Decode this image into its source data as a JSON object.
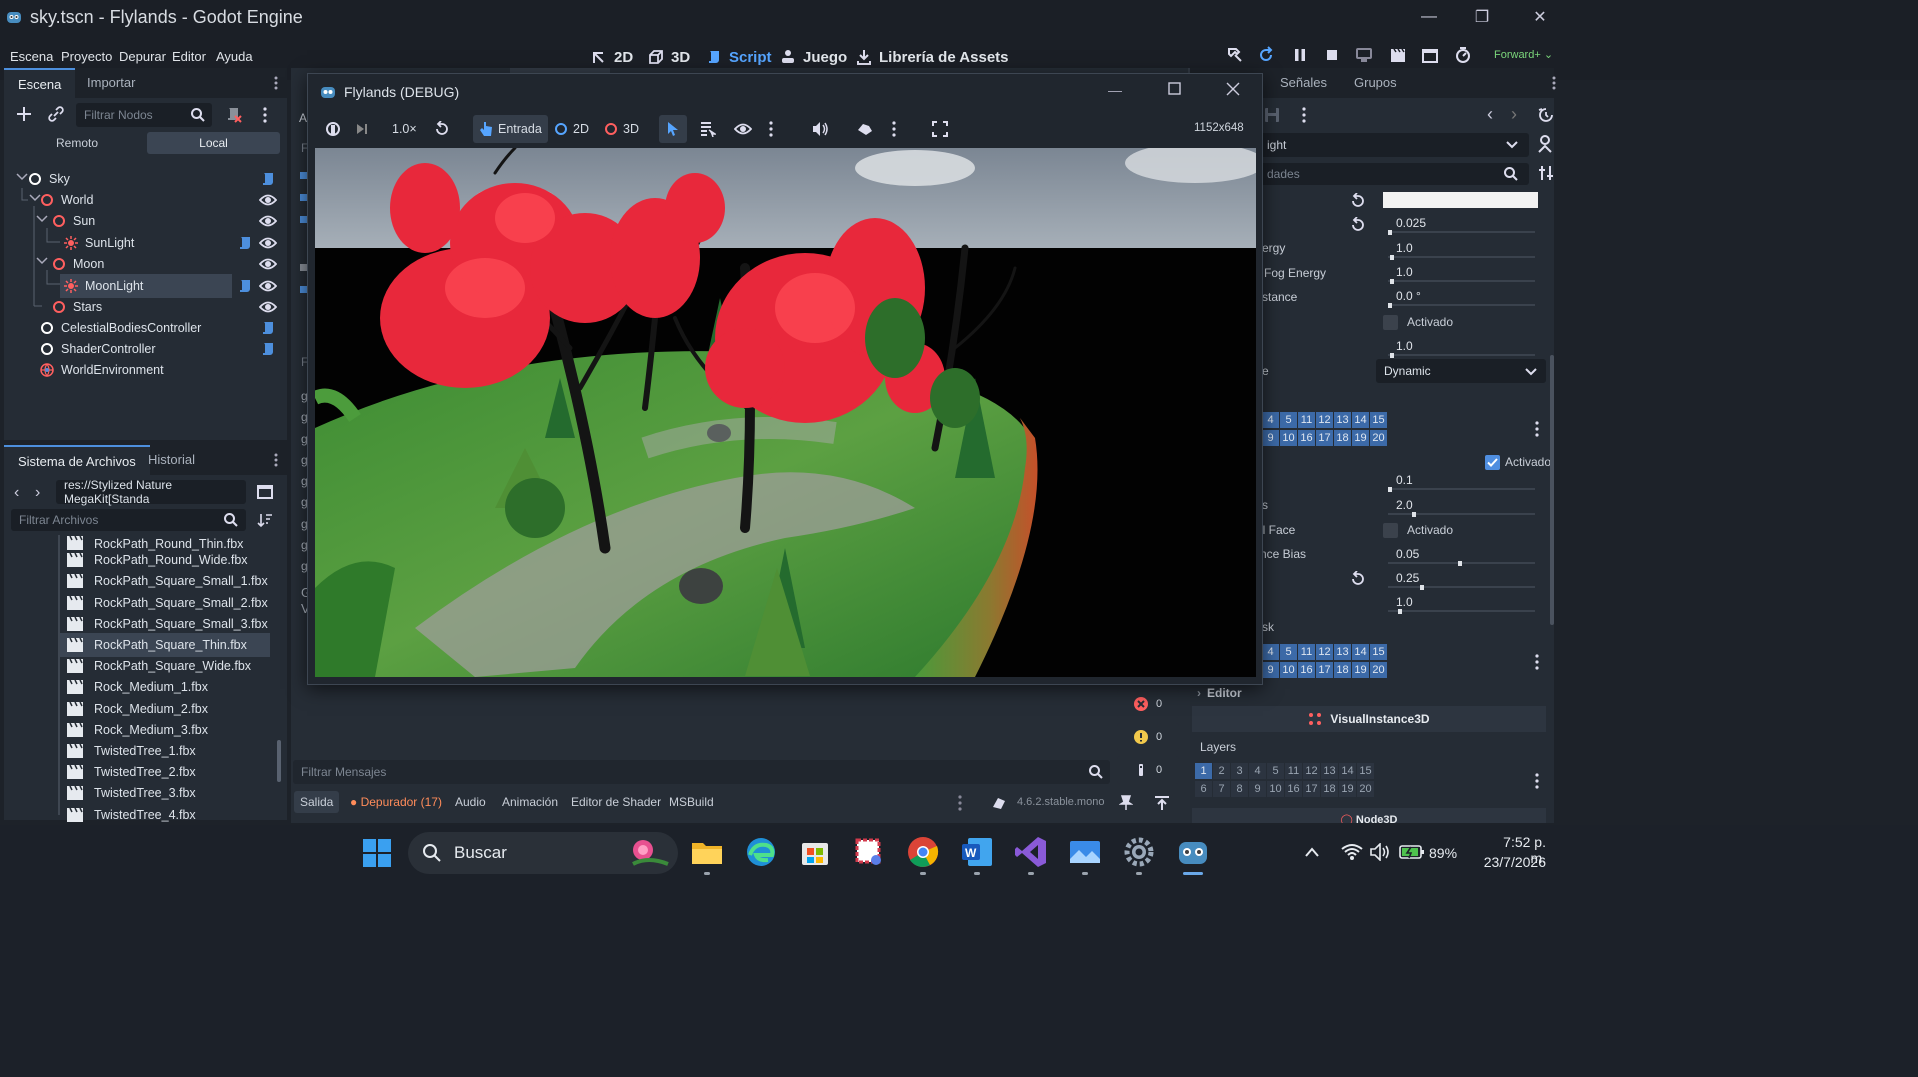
{
  "window": {
    "title": "sky.tscn - Flylands - Godot Engine",
    "minimize": "—",
    "maximize": "❐",
    "close": "✕"
  },
  "menu": [
    "Escena",
    "Proyecto",
    "Depurar",
    "Editor",
    "Ayuda"
  ],
  "workspaces": [
    {
      "label": "2D",
      "icon": "2d-icon"
    },
    {
      "label": "3D",
      "icon": "3d-icon"
    },
    {
      "label": "Script",
      "icon": "script-icon",
      "active": true
    },
    {
      "label": "Juego",
      "icon": "game-icon"
    },
    {
      "label": "Librería de Assets",
      "icon": "asset-library-icon"
    }
  ],
  "renderer": "Forward+",
  "scene_dock": {
    "tabs": [
      "Escena",
      "Importar"
    ],
    "filter_placeholder": "Filtrar Nodos",
    "remote_label": "Remoto",
    "local_label": "Local",
    "nodes": [
      {
        "name": "Sky",
        "icon": "node3d-icon"
      },
      {
        "name": "World",
        "icon": "node3d-icon"
      },
      {
        "name": "Sun",
        "icon": "node3d-icon"
      },
      {
        "name": "SunLight",
        "icon": "directional-light-icon"
      },
      {
        "name": "Moon",
        "icon": "node3d-icon"
      },
      {
        "name": "MoonLight",
        "icon": "directional-light-icon",
        "selected": true
      },
      {
        "name": "Stars",
        "icon": "node3d-icon"
      },
      {
        "name": "CelestialBodiesController",
        "icon": "node-icon"
      },
      {
        "name": "ShaderController",
        "icon": "node-icon"
      },
      {
        "name": "WorldEnvironment",
        "icon": "world-environment-icon"
      }
    ]
  },
  "filesystem_dock": {
    "tabs": [
      "Sistema de Archivos",
      "Historial"
    ],
    "path": "res://Stylized Nature MegaKit[Standa",
    "filter_placeholder": "Filtrar Archivos",
    "files": [
      "RockPath_Round_Thin.fbx",
      "RockPath_Round_Wide.fbx",
      "RockPath_Square_Small_1.fbx",
      "RockPath_Square_Small_2.fbx",
      "RockPath_Square_Small_3.fbx",
      "RockPath_Square_Thin.fbx",
      "RockPath_Square_Wide.fbx",
      "Rock_Medium_1.fbx",
      "Rock_Medium_2.fbx",
      "Rock_Medium_3.fbx",
      "TwistedTree_1.fbx",
      "TwistedTree_2.fbx",
      "TwistedTree_3.fbx",
      "TwistedTree_4.fbx"
    ],
    "selected_file": "RockPath_Square_Thin.fbx"
  },
  "debug_window": {
    "title": "Flylands (DEBUG)",
    "speed": "1.0×",
    "input_label": "Entrada",
    "mode_2d": "2D",
    "mode_3d": "3D",
    "resolution": "1152x648"
  },
  "behind_fragments": {
    "tab_a": "A",
    "f1": "F",
    "f2": "F",
    "g_letters": [
      "g",
      "g",
      "g",
      "g",
      "g",
      "g",
      "g",
      "g",
      "g",
      "g"
    ],
    "gv": [
      "G",
      "V"
    ]
  },
  "inspector": {
    "tabs": [
      "Señales",
      "Grupos"
    ],
    "object_name": "ight",
    "filter_fragment": "dades",
    "properties": [
      {
        "label": "",
        "value": "0.025",
        "revert": true
      },
      {
        "label": "ergy",
        "value": "1.0"
      },
      {
        "label": "Fog Energy",
        "value": "1.0"
      },
      {
        "label": "stance",
        "value": "0.0 °"
      },
      {
        "label": "",
        "checkbox": "Activado"
      },
      {
        "label": "",
        "value": "1.0"
      },
      {
        "label": "e",
        "dropdown": "Dynamic"
      }
    ],
    "layers_row1": [
      "4",
      "5",
      "11",
      "12",
      "13",
      "14",
      "15"
    ],
    "layers_row2": [
      "9",
      "10",
      "16",
      "17",
      "18",
      "19",
      "20"
    ],
    "shadow_enabled": "Activado",
    "shadow_props": [
      {
        "label": "",
        "value": "0.1"
      },
      {
        "label": "s",
        "value": "2.0"
      },
      {
        "label": "ll Face",
        "checkbox": "Activado"
      },
      {
        "label": "nce Bias",
        "value": "0.05"
      },
      {
        "label": "",
        "value": "0.25",
        "revert": true
      },
      {
        "label": "",
        "value": "1.0"
      }
    ],
    "mask_label": "sk",
    "mask_row1": [
      "4",
      "5",
      "11",
      "12",
      "13",
      "14",
      "15"
    ],
    "mask_row2": [
      "9",
      "10",
      "16",
      "17",
      "18",
      "19",
      "20"
    ],
    "editor_section": "Editor",
    "visual_instance": "VisualInstance3D",
    "layers_label": "Layers",
    "vi_row1": [
      "1",
      "2",
      "3",
      "4",
      "5",
      "11",
      "12",
      "13",
      "14",
      "15"
    ],
    "vi_row2": [
      "6",
      "7",
      "8",
      "9",
      "10",
      "16",
      "17",
      "18",
      "19",
      "20"
    ],
    "node3d_fragment": "Node3D"
  },
  "output": {
    "errors": "0",
    "warnings": "0",
    "messages": "0",
    "filter_placeholder": "Filtrar Mensajes",
    "tabs": [
      "Salida",
      "Depurador (17)",
      "Audio",
      "Animación",
      "Editor de Shader",
      "MSBuild"
    ],
    "version": "4.6.2.stable.mono"
  },
  "taskbar": {
    "search": "Buscar",
    "battery": "89%",
    "time": "7:52 p. m.",
    "date": "23/7/2026"
  },
  "colors": {
    "accent": "#56a5ff",
    "node_red": "#ff5f5f",
    "script_blue": "#4d8fdd"
  }
}
